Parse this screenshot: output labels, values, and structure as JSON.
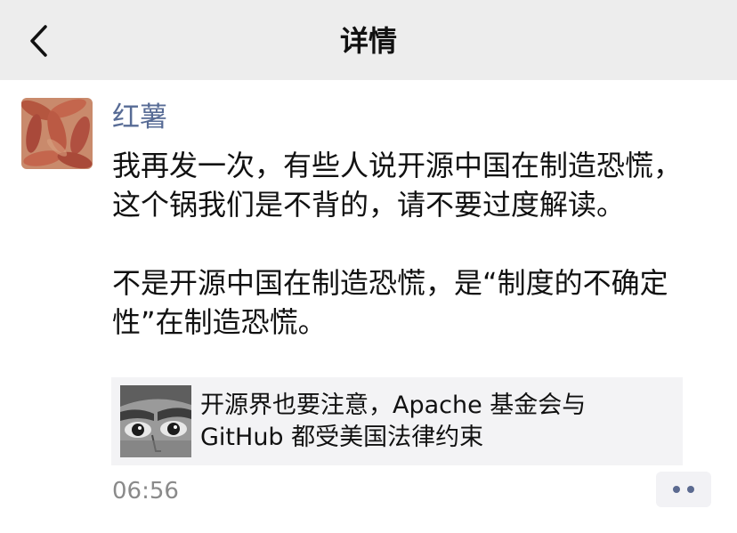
{
  "header": {
    "title": "详情",
    "back_icon": "chevron-left-icon"
  },
  "post": {
    "author": "红薯",
    "paragraphs": [
      "我再发一次，有些人说开源中国在制造恐慌，这个锅我们是不背的，请不要过度解读。",
      "不是开源中国在制造恐慌，是“制度的不确定性”在制造恐慌。"
    ],
    "link_card": {
      "title": "开源界也要注意，Apache 基金会与 GitHub 都受美国法律约束"
    },
    "time": "06:56",
    "more_icon": "more-dots-icon"
  },
  "colors": {
    "nav_background": "#ededed",
    "author_name": "#576b95",
    "timestamp": "#8a8a8a",
    "card_background": "#f3f3f5",
    "more_dots": "#5b6a90"
  }
}
